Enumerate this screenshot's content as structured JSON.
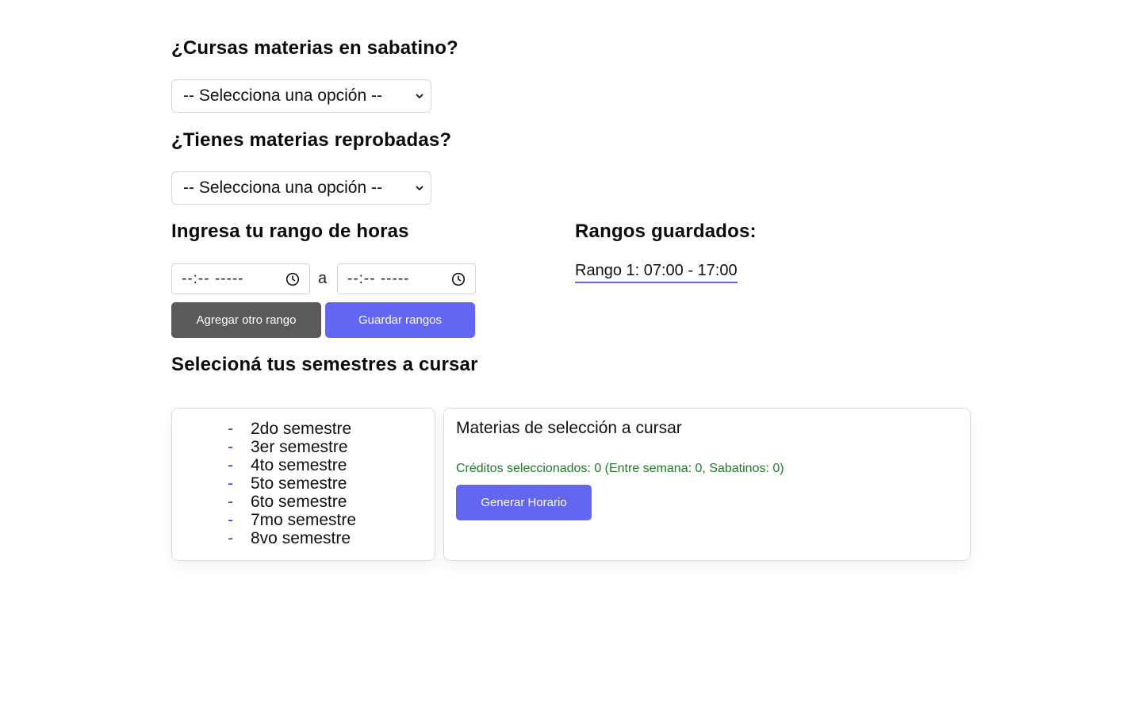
{
  "sabatino": {
    "question": "¿Cursas materias en sabatino?",
    "select_value": "-- Selecciona una opción --"
  },
  "reprobadas": {
    "question": "¿Tienes materias reprobadas?",
    "select_value": "-- Selecciona una opción --"
  },
  "hours": {
    "heading": "Ingresa tu rango de horas",
    "start_placeholder": "--:-- -----",
    "separator": "a",
    "end_placeholder": "--:-- -----",
    "add_button": "Agregar otro rango",
    "save_button": "Guardar rangos"
  },
  "saved": {
    "heading": "Rangos guardados:",
    "items": [
      "Rango 1: 07:00 - 17:00"
    ]
  },
  "semesters": {
    "heading": "Selecioná tus semestres a cursar",
    "dash": "-",
    "items": [
      "2do semestre",
      "3er semestre",
      "4to semestre",
      "5to semestre",
      "6to semestre",
      "7mo semestre",
      "8vo semestre"
    ]
  },
  "selection": {
    "title": "Materias de selección a cursar",
    "credits": "Créditos seleccionados: 0 (Entre semana: 0, Sabatinos: 0)",
    "generate_button": "Generar Horario"
  },
  "colors": {
    "accent": "#6366f1",
    "dark_button": "#5a5a5a",
    "credits_text": "#1f7a2a",
    "dash": "#3b3bd6"
  },
  "icons": {
    "select_chevron": "chevron-down-icon",
    "time_picker": "clock-icon"
  }
}
